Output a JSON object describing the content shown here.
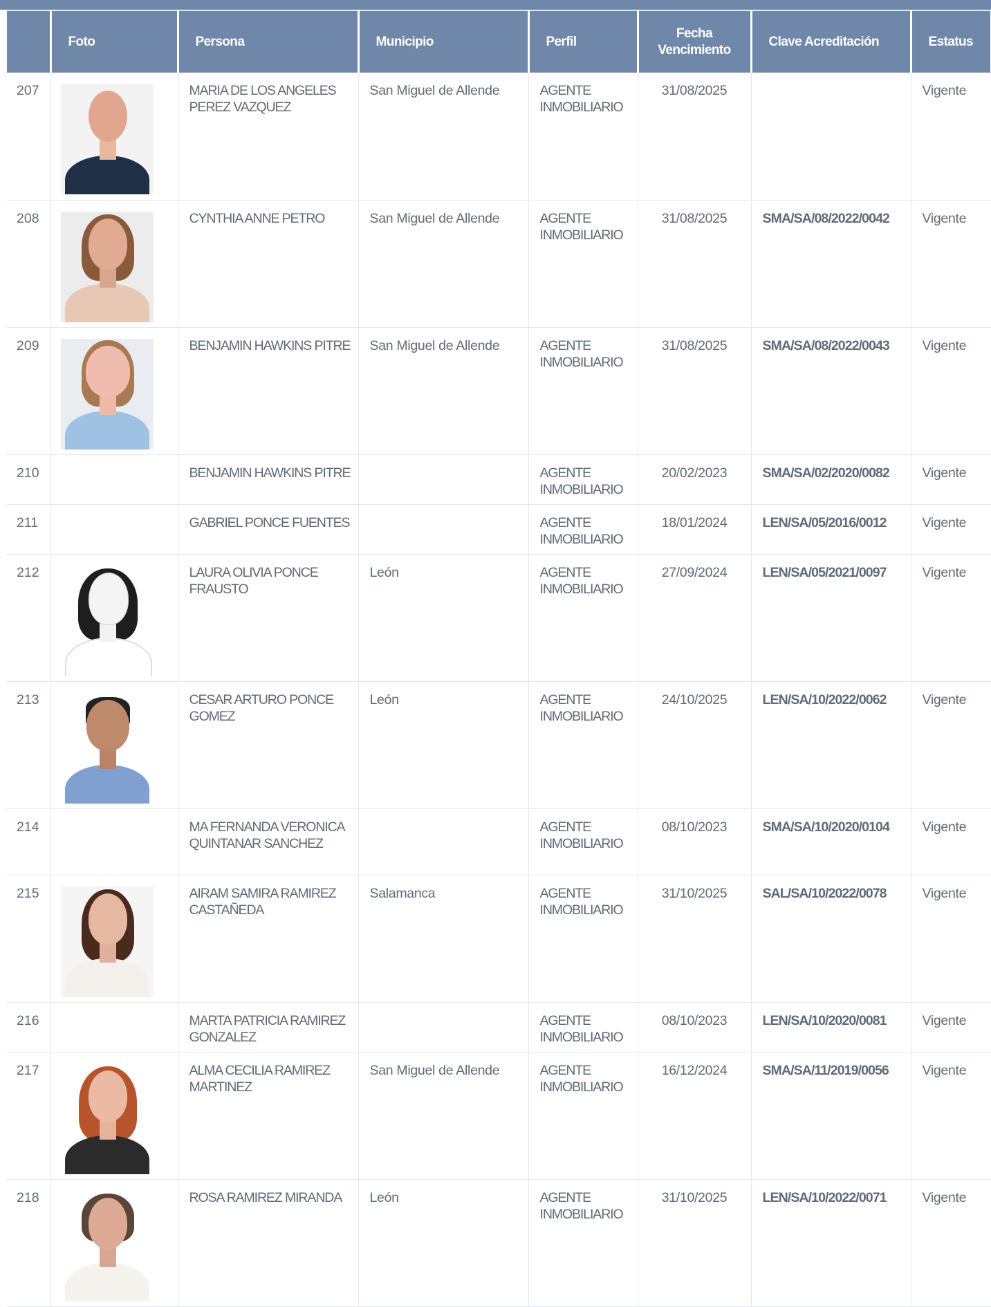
{
  "columns": {
    "num": "",
    "foto": "Foto",
    "persona": "Persona",
    "municipio": "Municipio",
    "perfil": "Perfil",
    "fecha": "Fecha Vencimiento",
    "clave": "Clave Acreditación",
    "estatus": "Estatus"
  },
  "rows": [
    {
      "num": "207",
      "persona": "MARIA DE LOS ANGELES PEREZ VAZQUEZ",
      "municipio": "San Miguel de Allende",
      "perfil": "AGENTE INMOBILIARIO",
      "fecha": "31/08/2025",
      "clave": "",
      "estatus": "Vigente"
    },
    {
      "num": "208",
      "persona": "CYNTHIA ANNE PETRO",
      "municipio": "San Miguel de Allende",
      "perfil": "AGENTE INMOBILIARIO",
      "fecha": "31/08/2025",
      "clave": "SMA/SA/08/2022/0042",
      "estatus": "Vigente"
    },
    {
      "num": "209",
      "persona": "BENJAMIN HAWKINS PITRE",
      "municipio": "San Miguel de Allende",
      "perfil": "AGENTE INMOBILIARIO",
      "fecha": "31/08/2025",
      "clave": "SMA/SA/08/2022/0043",
      "estatus": "Vigente"
    },
    {
      "num": "210",
      "persona": "BENJAMIN HAWKINS PITRE",
      "municipio": "",
      "perfil": "AGENTE INMOBILIARIO",
      "fecha": "20/02/2023",
      "clave": "SMA/SA/02/2020/0082",
      "estatus": "Vigente"
    },
    {
      "num": "211",
      "persona": "GABRIEL PONCE FUENTES",
      "municipio": "",
      "perfil": "AGENTE INMOBILIARIO",
      "fecha": "18/01/2024",
      "clave": "LEN/SA/05/2016/0012",
      "estatus": "Vigente"
    },
    {
      "num": "212",
      "persona": "LAURA OLIVIA PONCE FRAUSTO",
      "municipio": "León",
      "perfil": "AGENTE INMOBILIARIO",
      "fecha": "27/09/2024",
      "clave": "LEN/SA/05/2021/0097",
      "estatus": "Vigente"
    },
    {
      "num": "213",
      "persona": "CESAR ARTURO PONCE GOMEZ",
      "municipio": "León",
      "perfil": "AGENTE INMOBILIARIO",
      "fecha": "24/10/2025",
      "clave": "LEN/SA/10/2022/0062",
      "estatus": "Vigente"
    },
    {
      "num": "214",
      "persona": "MA FERNANDA VERONICA QUINTANAR SANCHEZ",
      "municipio": "",
      "perfil": "AGENTE INMOBILIARIO",
      "fecha": "08/10/2023",
      "clave": "SMA/SA/10/2020/0104",
      "estatus": "Vigente"
    },
    {
      "num": "215",
      "persona": "AIRAM SAMIRA RAMIREZ CASTAÑEDA",
      "municipio": "Salamanca",
      "perfil": "AGENTE INMOBILIARIO",
      "fecha": "31/10/2025",
      "clave": "SAL/SA/10/2022/0078",
      "estatus": "Vigente"
    },
    {
      "num": "216",
      "persona": "MARTA PATRICIA RAMIREZ GONZALEZ",
      "municipio": "",
      "perfil": "AGENTE INMOBILIARIO",
      "fecha": "08/10/2023",
      "clave": "LEN/SA/10/2020/0081",
      "estatus": "Vigente"
    },
    {
      "num": "217",
      "persona": "ALMA CECILIA RAMIREZ MARTINEZ",
      "municipio": "San Miguel de Allende",
      "perfil": "AGENTE INMOBILIARIO",
      "fecha": "16/12/2024",
      "clave": "SMA/SA/11/2019/0056",
      "estatus": "Vigente"
    },
    {
      "num": "218",
      "persona": "ROSA RAMIREZ MIRANDA",
      "municipio": "León",
      "perfil": "AGENTE INMOBILIARIO",
      "fecha": "31/10/2025",
      "clave": "LEN/SA/10/2022/0071",
      "estatus": "Vigente"
    }
  ],
  "colors": {
    "header_bg": "#6f88aa",
    "header_text": "#ffffff",
    "body_text": "#5f6b78",
    "grid_line": "#e3e8ef"
  }
}
